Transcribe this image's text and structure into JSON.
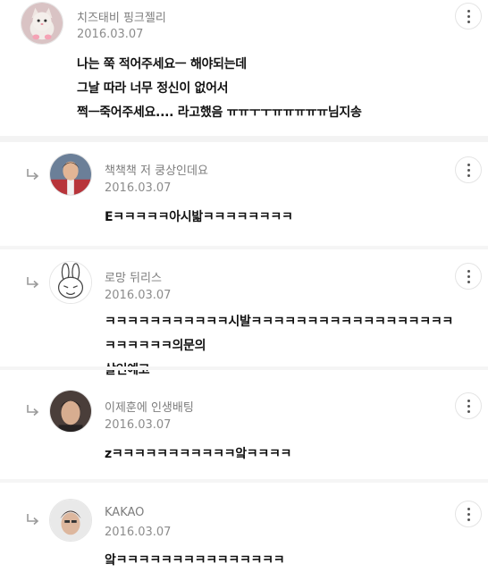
{
  "comments": [
    {
      "author": "치즈태비 핑크젤리",
      "date": "2016.03.07",
      "text": "나는 쭉 적어주세요ㅡ 해야되는데\n그날 따라 너무 정신이 없어서\n쩍ㅡ죽어주세요.... 라고했음 ㅠㅠㅜㅜㅠㅠㅠㅠㅠ님지송",
      "is_reply": false,
      "avatar": "cat-photo"
    },
    {
      "author": "책책책 저 쿵상인데요",
      "date": "2016.03.07",
      "text": "Eㅋㅋㅋㅋㅋ아시밟ㅋㅋㅋㅋㅋㅋㅋㅋ",
      "is_reply": true,
      "avatar": "person-red-jacket"
    },
    {
      "author": "로망 뒤리스",
      "date": "2016.03.07",
      "text": "ㅋㅋㅋㅋㅋㅋㅋㅋㅋㅋㅋ시발ㅋㅋㅋㅋㅋㅋㅋㅋㅋㅋㅋㅋㅋㅋㅋㅋㅋㅋㅋㅋㅋㅋㅋㅋ의문의\n살인예고",
      "is_reply": true,
      "avatar": "rabbit-drawing"
    },
    {
      "author": "이제훈에 인생배팅",
      "date": "2016.03.07",
      "text": "zㅋㅋㅋㅋㅋㅋㅋㅋㅋㅋㅋ앜ㅋㅋㅋㅋ",
      "is_reply": true,
      "avatar": "person-portrait"
    },
    {
      "author": "KAKAO",
      "date": "2016.03.07",
      "text": "앜ㅋㅋㅋㅋㅋㅋㅋㅋㅋㅋㅋㅋㅋㅋㅋ",
      "is_reply": true,
      "avatar": "person-portrait-2"
    }
  ]
}
